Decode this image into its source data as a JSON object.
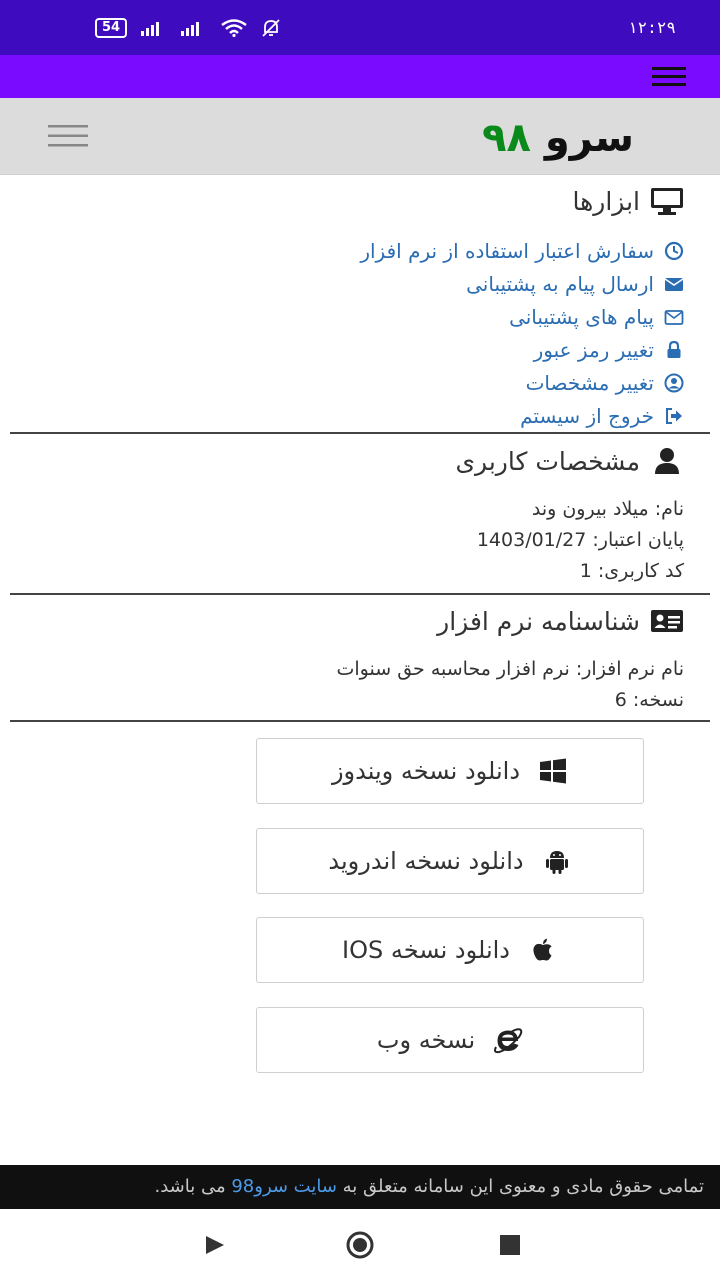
{
  "status_bar": {
    "battery": "54",
    "time": "۱۲:۲۹"
  },
  "header": {
    "logo_word": "سرو",
    "logo_number": "۹۸"
  },
  "tools": {
    "title": "ابزارها",
    "items": [
      {
        "label": "سفارش اعتبار استفاده از نرم افزار",
        "icon": "clock-icon"
      },
      {
        "label": "ارسال پیام به پشتیبانی",
        "icon": "envelope-icon"
      },
      {
        "label": "پیام های پشتیبانی",
        "icon": "envelope-outline-icon"
      },
      {
        "label": "تغییر رمز عبور",
        "icon": "lock-icon"
      },
      {
        "label": "تغییر مشخصات",
        "icon": "user-circle-icon"
      },
      {
        "label": "خروج از سیستم",
        "icon": "sign-out-icon"
      }
    ]
  },
  "user_info": {
    "title": "مشخصات کاربری",
    "name": "نام: میلاد بیرون وند",
    "expiry": "پایان اعتبار: 1403/01/27",
    "user_code": "کد کاربری: 1"
  },
  "software_id": {
    "title": "شناسنامه نرم افزار",
    "software_name": "نام نرم افزار: نرم افزار محاسبه حق سنوات",
    "version": "نسخه: 6"
  },
  "downloads": [
    {
      "label": "دانلود نسخه ویندوز",
      "icon": "windows-icon"
    },
    {
      "label": "دانلود نسخه اندروید",
      "icon": "android-icon"
    },
    {
      "label": "دانلود نسخه IOS",
      "icon": "apple-icon"
    },
    {
      "label": "نسخه وب",
      "icon": "internet-explorer-icon"
    }
  ],
  "footer": {
    "text_before": "تمامی حقوق مادی و معنوی این سامانه متعلق به ",
    "link_text": "سایت سرو98",
    "text_after": " می باشد."
  },
  "colors": {
    "status_bar": "#3f0bbf",
    "app_bar": "#7a0bff",
    "link": "#2a6db3",
    "logo_green": "#0a8a1a"
  }
}
